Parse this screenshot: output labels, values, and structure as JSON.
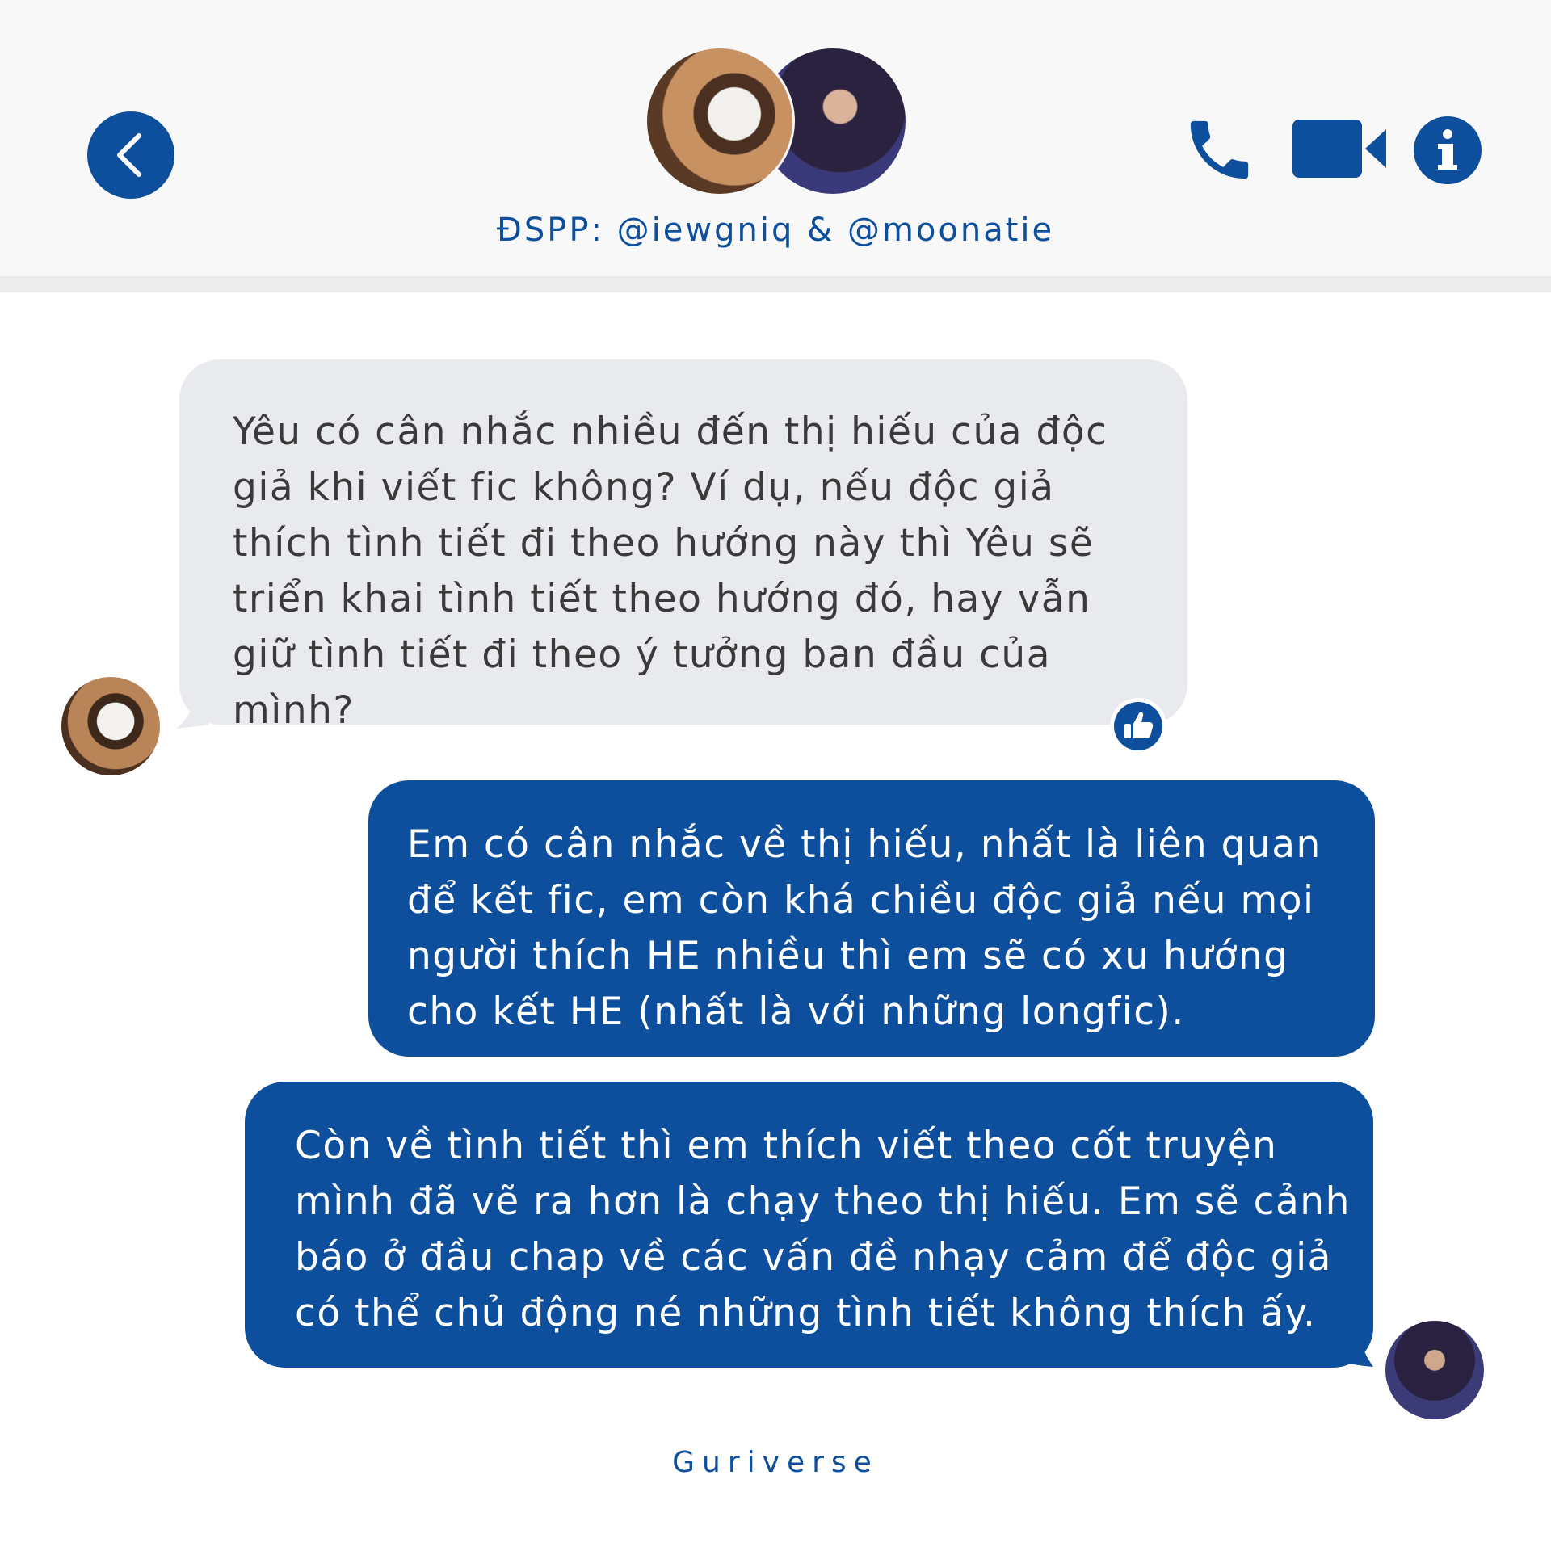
{
  "header": {
    "title": "ĐSPP: @iewgniq & @moonatie"
  },
  "messages": [
    {
      "direction": "incoming",
      "text": "Yêu có cân nhắc nhiều đến thị hiếu của độc giả khi viết fic không? Ví dụ, nếu độc giả thích tình tiết đi theo hướng này thì Yêu sẽ triển khai tình tiết theo hướng đó, hay vẫn giữ tình tiết đi theo ý tưởng ban đầu của mình?",
      "reaction": "thumbs-up-icon"
    },
    {
      "direction": "outgoing",
      "text": "Em có cân nhắc về thị hiếu, nhất là liên quan để kết fic, em còn khá chiều độc giả nếu mọi người thích HE nhiều thì em sẽ có xu hướng cho kết HE (nhất là với những longfic)."
    },
    {
      "direction": "outgoing",
      "text": "Còn về tình tiết thì em thích viết theo cốt truyện mình đã vẽ ra hơn là chạy theo thị hiếu. Em sẽ cảnh báo ở đầu chap về các vấn đề nhạy cảm để độc giả có thể chủ động né những tình tiết không thích ấy."
    }
  ],
  "footer": {
    "brand": "Guriverse"
  },
  "colors": {
    "accent": "#0d4f9c",
    "incoming_bubble": "#e8eaee",
    "header_bg": "#f8f8f8"
  }
}
